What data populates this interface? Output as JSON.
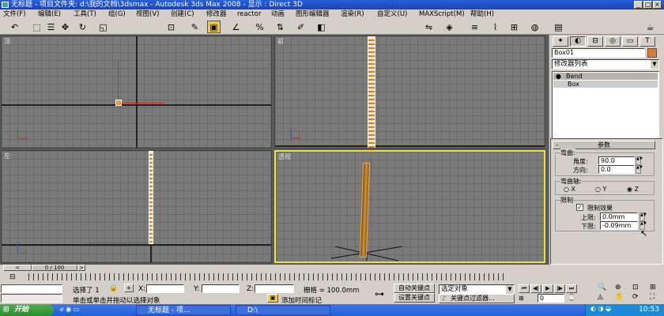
{
  "window": {
    "title": "无标题   - 项目文件夹: d:\\我的文档\\3dsmax     - Autodesk 3ds Max 2008     - 显示 : Direct 3D"
  },
  "menu": [
    "文件(F)",
    "编辑(E)",
    "工具(T)",
    "组(G)",
    "视图(V)",
    "创建(C)",
    "修改器",
    "reactor",
    "动画",
    "图形编辑器",
    "渲染(R)",
    "自定义(U)",
    "MAXScript(M)",
    "帮助(H)"
  ],
  "toolbar": {
    "view_select": "视图",
    "view_select2": "视图",
    "named_selection": ""
  },
  "viewports": {
    "top_label": "顶",
    "front_label": "前",
    "left_label": "左",
    "perspective_label": "透视"
  },
  "command_panel": {
    "object_name": "Box01",
    "color": "#e07a30",
    "modifier_list": "修改器列表",
    "stack": [
      "Bend",
      "Box"
    ],
    "rollout_title": "参数",
    "bend_group": "弯曲:",
    "angle_label": "角度:",
    "angle_value": "90.0",
    "direction_label": "方向:",
    "direction_value": "0.0",
    "axis_group": "弯曲轴:",
    "axis_x": "X",
    "axis_y": "Y",
    "axis_z": "Z",
    "axis_selected": "Z",
    "limit_group": "限制",
    "limit_effect": "限制效果",
    "limit_checked": true,
    "upper_label": "上限:",
    "upper_value": "0.0mm",
    "lower_label": "下限:",
    "lower_value": "-0.09mm"
  },
  "timeline": {
    "frame_display": "0 / 100",
    "ticks": [
      "0",
      "10",
      "20",
      "30",
      "40",
      "50",
      "60",
      "70",
      "80",
      "90",
      "100"
    ]
  },
  "status": {
    "selected": "选择了 1",
    "x_label": "X:",
    "y_label": "Y:",
    "z_label": "Z:",
    "grid": "栅格 = 100.0mm",
    "auto_key": "自动关键点",
    "set_key": "设置关键点",
    "selected_object": "选定对象",
    "key_filters": "关键点过滤器...",
    "prompt": "单击或单击并拖动以选择对象",
    "add_time_tag": "添加时间标记",
    "frame_value": "0"
  },
  "taskbar": {
    "start": "开始",
    "tasks": [
      "无标题   - 项...",
      "D:\\"
    ],
    "clock": "10:53"
  }
}
